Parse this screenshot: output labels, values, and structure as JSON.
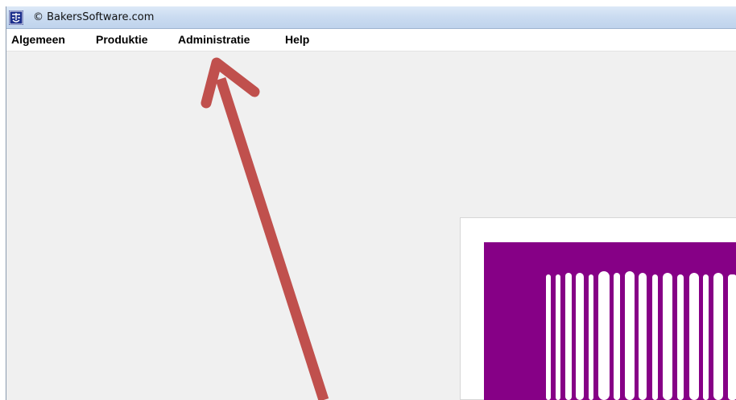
{
  "window": {
    "title": "© BakersSoftware.com",
    "icon": "bakerssoftware-app-icon"
  },
  "menubar": {
    "items": [
      {
        "label": "Algemeen"
      },
      {
        "label": "Produktie"
      },
      {
        "label": "Administratie"
      },
      {
        "label": "Help"
      }
    ]
  },
  "splash": {
    "logo": "bakerssoftware-logo-bars",
    "background_color": "#860086",
    "bar_color": "#ffffff"
  },
  "annotation": {
    "arrow_color": "#c0504d",
    "points_to": "Administratie"
  }
}
